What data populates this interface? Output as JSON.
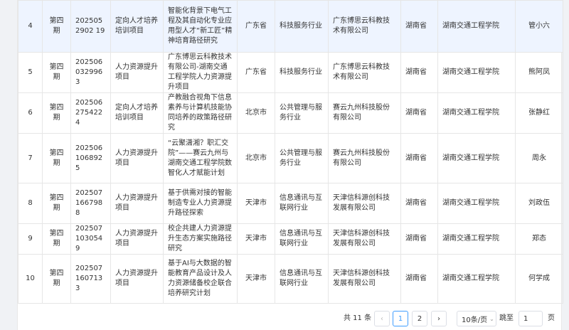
{
  "rows": [
    {
      "no": "4",
      "period": "第四期",
      "id": "2025052902 19",
      "type": "定向人才培养培训项目",
      "title": "智能化背景下电气工程及其自动化专业应用型人才“新工匠”精神培育路径研究",
      "province": "广东省",
      "industry": "科技服务行业",
      "company": "广东博思云科教技术有限公司",
      "prov2": "湖南省",
      "school": "湖南交通工程学院",
      "person": "管小六"
    },
    {
      "no": "5",
      "period": "第四期",
      "id": "2025060329963",
      "type": "人力资源提升项目",
      "title": "广东博思云科教技术有限公司-湖南交通工程学院人力资源提升项目",
      "province": "广东省",
      "industry": "科技服务行业",
      "company": "广东博思云科教技术有限公司",
      "prov2": "湖南省",
      "school": "湖南交通工程学院",
      "person": "熊阿凤"
    },
    {
      "no": "6",
      "period": "第四期",
      "id": "2025062754224",
      "type": "定向人才培养培训项目",
      "title": "产教融合视角下信息素养与计算机技能协同培养的政策路径研究",
      "province": "北京市",
      "industry": "公共管理与服务行业",
      "company": "赛云九州科技股份有限公司",
      "prov2": "湖南省",
      "school": "湖南交通工程学院",
      "person": "张静红"
    },
    {
      "no": "7",
      "period": "第四期",
      "id": "2025061068925",
      "type": "人力资源提升项目",
      "title": "“云聚潇湘？职汇交院”——赛云九州与湖南交通工程学院数智化人才赋能计划",
      "province": "北京市",
      "industry": "公共管理与服务行业",
      "company": "赛云九州科技股份有限公司",
      "prov2": "湖南省",
      "school": "湖南交通工程学院",
      "person": "周永"
    },
    {
      "no": "8",
      "period": "第四期",
      "id": "2025071667988",
      "type": "人力资源提升项目",
      "title": "基于供需对接的智能制造专业人力资源提升路径探索",
      "province": "天津市",
      "industry": "信息通讯与互联网行业",
      "company": "天津信科源创科技发展有限公司",
      "prov2": "湖南省",
      "school": "湖南交通工程学院",
      "person": "刘政伍"
    },
    {
      "no": "9",
      "period": "第四期",
      "id": "2025071030549",
      "type": "人力资源提升项目",
      "title": "校企共建人力资源提升生态方案实施路径研究",
      "province": "天津市",
      "industry": "信息通讯与互联网行业",
      "company": "天津信科源创科技发展有限公司",
      "prov2": "湖南省",
      "school": "湖南交通工程学院",
      "person": "郑态"
    },
    {
      "no": "10",
      "period": "第四期",
      "id": "2025071607133",
      "type": "人力资源提升项目",
      "title": "基于AI与大数据的智能教育产品设计及人力资源储备校企联合培养研究计划",
      "province": "天津市",
      "industry": "信息通讯与互联网行业",
      "company": "天津信科源创科技发展有限公司",
      "prov2": "湖南省",
      "school": "湖南交通工程学院",
      "person": "何学成"
    }
  ],
  "pagination": {
    "total": "共 11 条",
    "prev": "‹",
    "page1": "1",
    "page2": "2",
    "next": "›",
    "page_size": "10条/页",
    "jump_label": "跳至",
    "jump_value": "1",
    "page_unit": "页"
  },
  "icons": {
    "size_dropdown": "chevron-down-icon"
  }
}
